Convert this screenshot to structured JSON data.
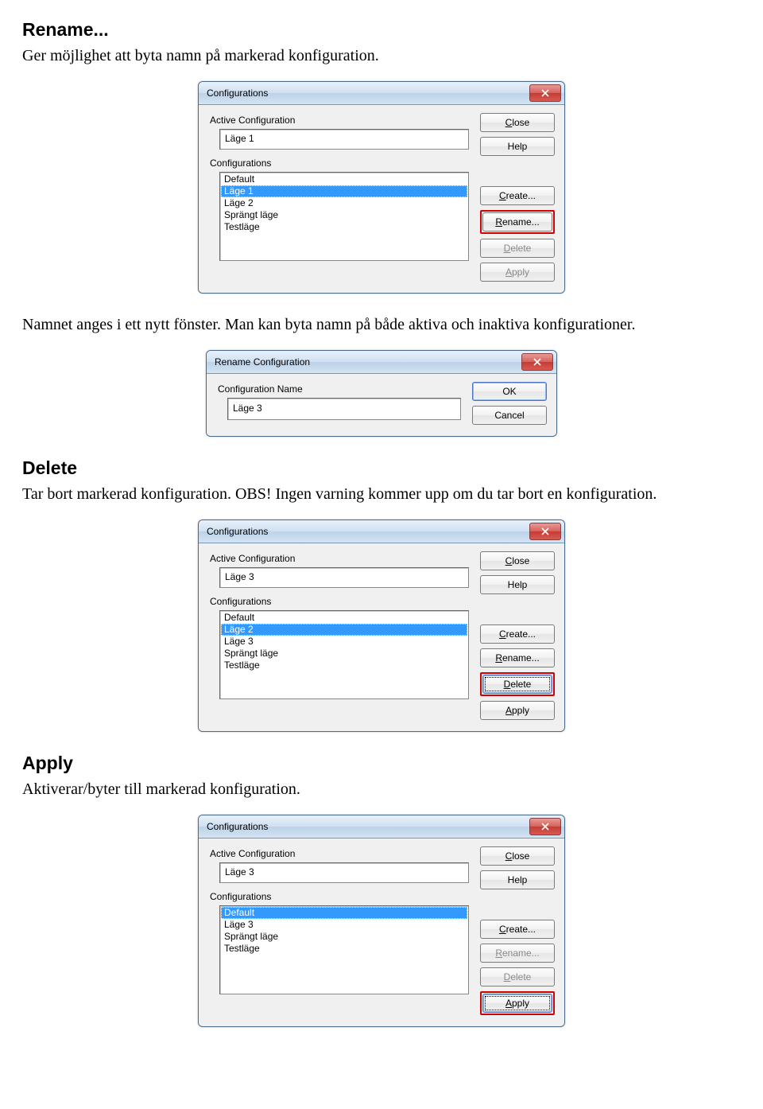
{
  "sections": {
    "rename": {
      "title": "Rename...",
      "para": "Ger möjlighet att byta namn på markerad konfiguration.",
      "para2": "Namnet anges i ett nytt fönster. Man kan byta namn på både aktiva och inaktiva konfigurationer."
    },
    "delete": {
      "title": "Delete",
      "para": "Tar bort markerad konfiguration. OBS! Ingen varning kommer upp om du tar bort en konfiguration."
    },
    "apply": {
      "title": "Apply",
      "para": "Aktiverar/byter till markerad konfiguration."
    }
  },
  "dlg": {
    "main_title": "Configurations",
    "active_label": "Active Configuration",
    "configs_label": "Configurations",
    "close_label": "Close",
    "close_u": "C",
    "help_label": "Help",
    "create_label": "reate...",
    "create_u": "C",
    "rename_label": "ename...",
    "rename_u": "R",
    "delete_label": "elete",
    "delete_u": "D",
    "apply_label": "pply",
    "apply_u": "A"
  },
  "dlg1": {
    "active": "Läge 1",
    "items": [
      "Default",
      "Läge 1",
      "Läge 2",
      "Sprängt läge",
      "Testläge"
    ],
    "selected_index": 1
  },
  "rename_dlg": {
    "title": "Rename Configuration",
    "label": "Configuration Name",
    "value": "Läge 3",
    "ok": "OK",
    "cancel": "Cancel"
  },
  "dlg2": {
    "active": "Läge 3",
    "items": [
      "Default",
      "Läge 2",
      "Läge 3",
      "Sprängt läge",
      "Testläge"
    ],
    "selected_index": 1
  },
  "dlg3": {
    "active": "Läge 3",
    "items": [
      "Default",
      "Läge 3",
      "Sprängt läge",
      "Testläge"
    ],
    "selected_index": 0
  }
}
